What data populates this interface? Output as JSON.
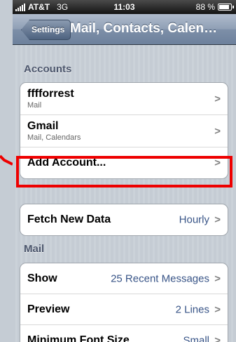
{
  "status_bar": {
    "carrier": "AT&T",
    "network": "3G",
    "time": "11:03",
    "battery": "88 %",
    "battery_level": 0.88
  },
  "nav": {
    "back_label": "Settings",
    "title": "Mail, Contacts, Calen…"
  },
  "accounts": {
    "header": "Accounts",
    "items": [
      {
        "title": "fffforrest",
        "subtitle": "Mail"
      },
      {
        "title": "Gmail",
        "subtitle": "Mail, Calendars"
      },
      {
        "title": "Add Account..."
      }
    ]
  },
  "fetch": {
    "label": "Fetch New Data",
    "value": "Hourly"
  },
  "mail": {
    "header": "Mail",
    "items": [
      {
        "label": "Show",
        "value": "25 Recent Messages"
      },
      {
        "label": "Preview",
        "value": "2 Lines"
      },
      {
        "label": "Minimum Font Size",
        "value": "Small"
      }
    ]
  },
  "colors": {
    "highlight": "#ee0000",
    "value_text": "#385487",
    "section_header": "#4c566c"
  },
  "icons": {
    "chevron": "chevron-right-icon",
    "signal": "signal-bars-icon",
    "battery": "battery-icon"
  }
}
